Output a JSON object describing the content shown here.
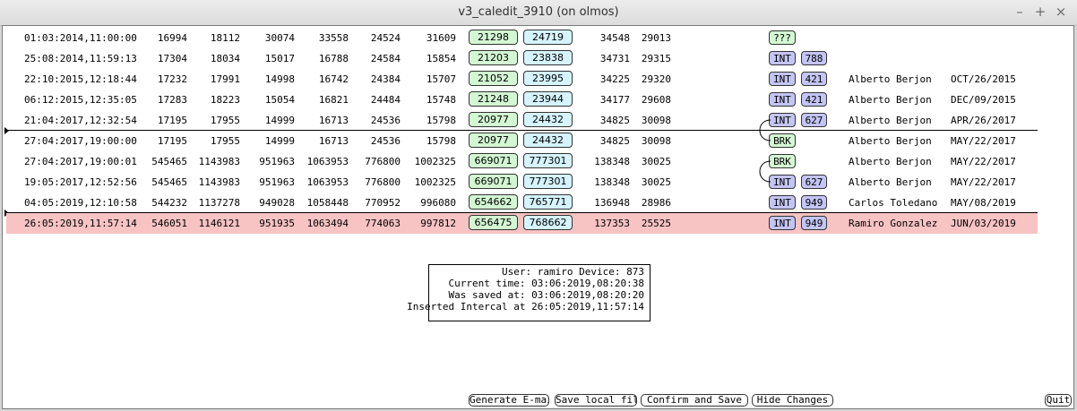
{
  "window": {
    "title": "v3_caledit_3910 (on olmos)",
    "min_label": "–",
    "max_label": "+",
    "close_label": "×"
  },
  "rows": [
    {
      "datetime": "01:03:2014,11:00:00",
      "v1": "16994",
      "v2": "18112",
      "v3": "30074",
      "v4": "33558",
      "v5": "24524",
      "v6": "31609",
      "g": "21298",
      "c": "24719",
      "v7": "34548",
      "v8": "29013",
      "type": "???",
      "typeClass": "q",
      "code": "",
      "user": "",
      "date": "",
      "selected": false,
      "sepAbove": false
    },
    {
      "datetime": "25:08:2014,11:59:13",
      "v1": "17304",
      "v2": "18034",
      "v3": "15017",
      "v4": "16788",
      "v5": "24584",
      "v6": "15854",
      "g": "21203",
      "c": "23838",
      "v7": "34731",
      "v8": "29315",
      "type": "INT",
      "typeClass": "int",
      "code": "788",
      "user": "",
      "date": "",
      "selected": false,
      "sepAbove": false
    },
    {
      "datetime": "22:10:2015,12:18:44",
      "v1": "17232",
      "v2": "17991",
      "v3": "14998",
      "v4": "16742",
      "v5": "24384",
      "v6": "15707",
      "g": "21052",
      "c": "23995",
      "v7": "34225",
      "v8": "29320",
      "type": "INT",
      "typeClass": "int",
      "code": "421",
      "user": "Alberto Berjon",
      "date": "OCT/26/2015",
      "selected": false,
      "sepAbove": false
    },
    {
      "datetime": "06:12:2015,12:35:05",
      "v1": "17283",
      "v2": "18223",
      "v3": "15054",
      "v4": "16821",
      "v5": "24484",
      "v6": "15748",
      "g": "21248",
      "c": "23944",
      "v7": "34177",
      "v8": "29608",
      "type": "INT",
      "typeClass": "int",
      "code": "421",
      "user": "Alberto Berjon",
      "date": "DEC/09/2015",
      "selected": false,
      "sepAbove": false
    },
    {
      "datetime": "21:04:2017,12:32:54",
      "v1": "17195",
      "v2": "17955",
      "v3": "14999",
      "v4": "16713",
      "v5": "24536",
      "v6": "15798",
      "g": "20977",
      "c": "24432",
      "v7": "34825",
      "v8": "30098",
      "type": "INT",
      "typeClass": "int",
      "code": "627",
      "user": "Alberto Berjon",
      "date": "APR/26/2017",
      "selected": false,
      "sepAbove": false
    },
    {
      "datetime": "27:04:2017,19:00:00",
      "v1": "17195",
      "v2": "17955",
      "v3": "14999",
      "v4": "16713",
      "v5": "24536",
      "v6": "15798",
      "g": "20977",
      "c": "24432",
      "v7": "34825",
      "v8": "30098",
      "type": "BRK",
      "typeClass": "brk",
      "code": "",
      "user": "Alberto Berjon",
      "date": "MAY/22/2017",
      "selected": false,
      "sepAbove": true
    },
    {
      "datetime": "27:04:2017,19:00:01",
      "v1": "545465",
      "v2": "1143983",
      "v3": "951963",
      "v4": "1063953",
      "v5": "776800",
      "v6": "1002325",
      "g": "669071",
      "c": "777301",
      "v7": "138348",
      "v8": "30025",
      "type": "BRK",
      "typeClass": "brk",
      "code": "",
      "user": "Alberto Berjon",
      "date": "MAY/22/2017",
      "selected": false,
      "sepAbove": false
    },
    {
      "datetime": "19:05:2017,12:52:56",
      "v1": "545465",
      "v2": "1143983",
      "v3": "951963",
      "v4": "1063953",
      "v5": "776800",
      "v6": "1002325",
      "g": "669071",
      "c": "777301",
      "v7": "138348",
      "v8": "30025",
      "type": "INT",
      "typeClass": "int",
      "code": "627",
      "user": "Alberto Berjon",
      "date": "MAY/22/2017",
      "selected": false,
      "sepAbove": false
    },
    {
      "datetime": "04:05:2019,12:10:58",
      "v1": "544232",
      "v2": "1137278",
      "v3": "949028",
      "v4": "1058448",
      "v5": "770952",
      "v6": "996080",
      "g": "654662",
      "c": "765771",
      "v7": "136948",
      "v8": "28986",
      "type": "INT",
      "typeClass": "int",
      "code": "949",
      "user": "Carlos Toledano",
      "date": "MAY/08/2019",
      "selected": false,
      "sepAbove": false
    },
    {
      "datetime": "26:05:2019,11:57:14",
      "v1": "546051",
      "v2": "1146121",
      "v3": "951935",
      "v4": "1063494",
      "v5": "774063",
      "v6": "997812",
      "g": "656475",
      "c": "768662",
      "v7": "137353",
      "v8": "25525",
      "type": "INT",
      "typeClass": "int",
      "code": "949",
      "user": "Ramiro Gonzalez",
      "date": "JUN/03/2019",
      "selected": true,
      "sepAbove": true
    }
  ],
  "info": {
    "line1": "User: ramiro Device: 873",
    "line2": "Current time: 03:06:2019,08:20:38",
    "line3": "Was saved at: 03:06:2019,08:20:20",
    "line4": "Inserted Intercal at 26:05:2019,11:57:14"
  },
  "buttons": {
    "email": "Generate E-mail",
    "save_local": "Save local file",
    "confirm": "Confirm and Save",
    "hide": "Hide Changes",
    "quit": "Quit"
  },
  "colors": {
    "selected_row": "#f7c3c3",
    "green_box": "#d3f7d3",
    "cyan_box": "#d5f4ff",
    "int_tag": "#c3c5f5"
  }
}
